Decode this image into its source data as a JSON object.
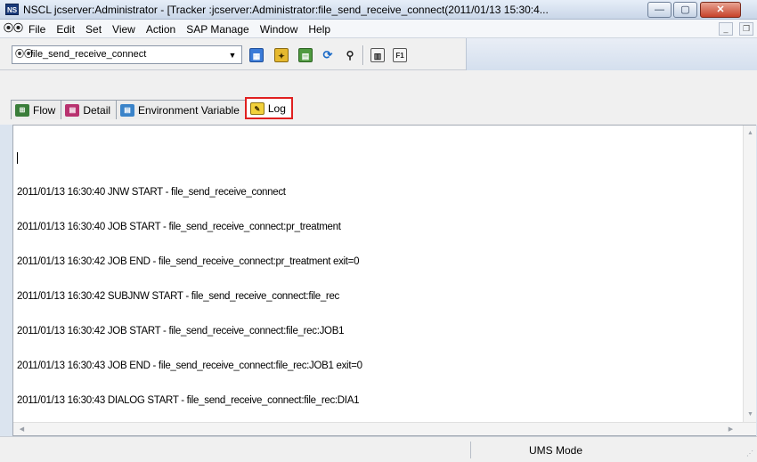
{
  "window": {
    "app_icon_label": "NS",
    "title": "NSCL jcserver:Administrator - [Tracker :jcserver:Administrator:file_send_receive_connect(2011/01/13 15:30:4...",
    "controls": {
      "minimize": "—",
      "maximize": "▢",
      "close": "✕"
    }
  },
  "menubar": {
    "items": [
      "File",
      "Edit",
      "Set",
      "View",
      "Action",
      "SAP Manage",
      "Window",
      "Help"
    ],
    "mdi_controls": {
      "minimize": "_",
      "restore": "❐",
      "close": "×"
    }
  },
  "toolbar": {
    "combo": {
      "value": "file_send_receive_connect",
      "icon": "jobnet-icon"
    },
    "buttons": [
      {
        "name": "open-icon",
        "glyph": "▦"
      },
      {
        "name": "tracker-icon",
        "glyph": "✦"
      },
      {
        "name": "detail-view-icon",
        "glyph": "▤"
      },
      {
        "name": "refresh-icon",
        "glyph": "⟳"
      },
      {
        "name": "search-icon",
        "glyph": "⚲"
      },
      {
        "name": "print-icon",
        "glyph": "▥"
      },
      {
        "name": "help-f1-icon",
        "glyph": "F1"
      }
    ]
  },
  "tabs": [
    {
      "label": "Flow",
      "icon": "flow-icon",
      "active": false
    },
    {
      "label": "Detail",
      "icon": "detail-icon",
      "active": false
    },
    {
      "label": "Environment Variable",
      "icon": "environment-icon",
      "active": false
    },
    {
      "label": "Log",
      "icon": "log-icon",
      "active": true
    }
  ],
  "log": {
    "lines": [
      "2011/01/13 16:30:40 JNW START - file_send_receive_connect",
      "2011/01/13 16:30:40 JOB START - file_send_receive_connect:pr_treatment",
      "2011/01/13 16:30:42 JOB END - file_send_receive_connect:pr_treatment exit=0",
      "2011/01/13 16:30:42 SUBJNW START - file_send_receive_connect:file_rec",
      "2011/01/13 16:30:42 JOB START - file_send_receive_connect:file_rec:JOB1",
      "2011/01/13 16:30:43 JOB END - file_send_receive_connect:file_rec:JOB1 exit=0",
      "2011/01/13 16:30:43 DIALOG START - file_send_receive_connect:file_rec:DIA1"
    ]
  },
  "statusbar": {
    "mode": "UMS Mode"
  },
  "colors": {
    "active_tab_border": "#e02020",
    "titlebar": "#c9d6e8",
    "close_button": "#c7422a"
  }
}
